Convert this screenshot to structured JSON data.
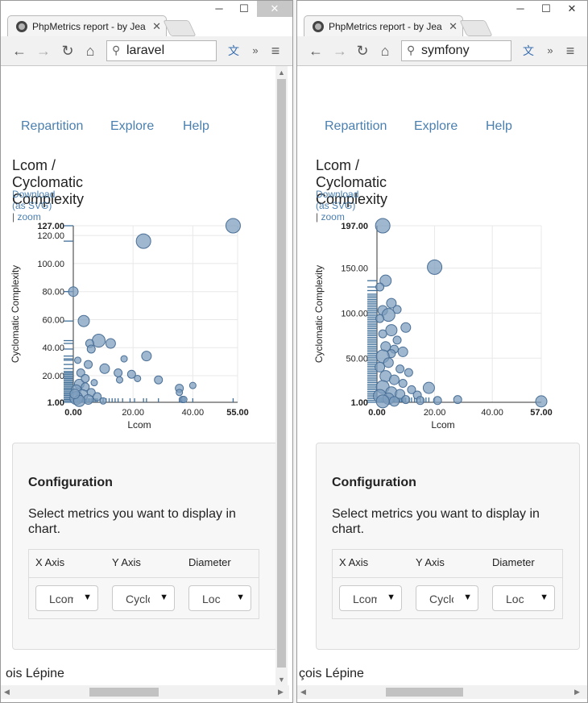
{
  "windows": [
    {
      "id": "left",
      "tab_title": "PhpMetrics report - by Jea",
      "omnibox_text": "laravel",
      "nav": [
        "Repartition",
        "Explore",
        "Help"
      ],
      "page_title": "Lcom / Cyclomatic Complexity",
      "download_link": "Download (as SVG)",
      "link_sep": "|",
      "zoom_link": "zoom",
      "footer_text": "ois Lépine",
      "chart_data": {
        "type": "scatter",
        "xlabel": "Lcom",
        "ylabel": "Cyclomatic Complexity",
        "xlim": [
          0,
          55
        ],
        "ylim": [
          1,
          127
        ],
        "x_ticks": [
          "0.00",
          "20.00",
          "40.00",
          "55.00"
        ],
        "x_tick_values": [
          0,
          20,
          40,
          55
        ],
        "y_ticks": [
          "1.00",
          "20.00",
          "40.00",
          "60.00",
          "80.00",
          "100.00",
          "120.00",
          "127.00"
        ],
        "y_tick_values": [
          1,
          20,
          40,
          60,
          80,
          100,
          120,
          127
        ],
        "bold_ticks": [
          "0.00",
          "55.00",
          "1.00",
          "127.00"
        ],
        "grid": true,
        "colors": {
          "fill": "#7f9fbf",
          "stroke": "#4a6f96",
          "rug": "#3f6f99"
        },
        "points": [
          {
            "x": 53.5,
            "y": 127,
            "d": 9
          },
          {
            "x": 23.5,
            "y": 116,
            "d": 9
          },
          {
            "x": 0,
            "y": 80,
            "d": 6
          },
          {
            "x": 3.5,
            "y": 59,
            "d": 7
          },
          {
            "x": 8.5,
            "y": 45,
            "d": 8
          },
          {
            "x": 5.5,
            "y": 43,
            "d": 5
          },
          {
            "x": 12.5,
            "y": 43,
            "d": 6
          },
          {
            "x": 6,
            "y": 39,
            "d": 5
          },
          {
            "x": 24.5,
            "y": 34,
            "d": 6
          },
          {
            "x": 17,
            "y": 32,
            "d": 4
          },
          {
            "x": 1.5,
            "y": 31,
            "d": 4
          },
          {
            "x": 5,
            "y": 28,
            "d": 5
          },
          {
            "x": 10.5,
            "y": 25,
            "d": 6
          },
          {
            "x": 15,
            "y": 22,
            "d": 5
          },
          {
            "x": 19.5,
            "y": 21,
            "d": 5
          },
          {
            "x": 2.5,
            "y": 22,
            "d": 5
          },
          {
            "x": 15.5,
            "y": 17,
            "d": 4
          },
          {
            "x": 21.5,
            "y": 18,
            "d": 4
          },
          {
            "x": 28.5,
            "y": 17,
            "d": 5
          },
          {
            "x": 40,
            "y": 13,
            "d": 4
          },
          {
            "x": 35.5,
            "y": 11,
            "d": 5
          },
          {
            "x": 35.5,
            "y": 8,
            "d": 4
          },
          {
            "x": 36.5,
            "y": 3,
            "d": 4
          },
          {
            "x": 37,
            "y": 3,
            "d": 4
          },
          {
            "x": 2,
            "y": 14,
            "d": 6
          },
          {
            "x": 4,
            "y": 12,
            "d": 5
          },
          {
            "x": 1,
            "y": 10,
            "d": 6
          },
          {
            "x": 6,
            "y": 8,
            "d": 5
          },
          {
            "x": 3,
            "y": 6,
            "d": 7
          },
          {
            "x": 8,
            "y": 5,
            "d": 5
          },
          {
            "x": 1,
            "y": 4,
            "d": 8
          },
          {
            "x": 5,
            "y": 3,
            "d": 6
          },
          {
            "x": 2,
            "y": 2,
            "d": 7
          },
          {
            "x": 10,
            "y": 2,
            "d": 4
          },
          {
            "x": 0.5,
            "y": 7,
            "d": 6
          },
          {
            "x": 4,
            "y": 18,
            "d": 5
          },
          {
            "x": 7,
            "y": 15,
            "d": 4
          }
        ],
        "rug_x": [
          0,
          0.5,
          1,
          1.5,
          2,
          2.5,
          3,
          3.5,
          4,
          4.5,
          5,
          5.5,
          6,
          6.5,
          7,
          7.5,
          8,
          9,
          10,
          11,
          12,
          13,
          14,
          15,
          16.5,
          19,
          20.5,
          23.5,
          24.5,
          28.5,
          35.5,
          36.5,
          37,
          40,
          53.5
        ],
        "rug_y": [
          1,
          2,
          3,
          4,
          5,
          6,
          7,
          8,
          9,
          10,
          11,
          12,
          13,
          14,
          15,
          16,
          17,
          18,
          19,
          20,
          21,
          22,
          23,
          25,
          28,
          31,
          32,
          34,
          39,
          43,
          45,
          59,
          80,
          116,
          127
        ]
      },
      "config": {
        "title": "Configuration",
        "description": "Select metrics you want to display in chart.",
        "headers": [
          "X Axis",
          "Y Axis",
          "Diameter"
        ],
        "selects": [
          "Lcom",
          "Cyclomatic",
          "Loc"
        ]
      }
    },
    {
      "id": "right",
      "tab_title": "PhpMetrics report - by Jea",
      "omnibox_text": "symfony",
      "nav": [
        "Repartition",
        "Explore",
        "Help"
      ],
      "page_title": "Lcom / Cyclomatic Complexity",
      "download_link": "Download (as SVG)",
      "link_sep": "|",
      "zoom_link": "zoom",
      "footer_text": "çois Lépine",
      "chart_data": {
        "type": "scatter",
        "xlabel": "Lcom",
        "ylabel": "Cyclomatic Complexity",
        "xlim": [
          0,
          57
        ],
        "ylim": [
          1,
          197
        ],
        "x_ticks": [
          "0.00",
          "20.00",
          "40.00",
          "57.00"
        ],
        "x_tick_values": [
          0,
          20,
          40,
          57
        ],
        "y_ticks": [
          "1.00",
          "50.00",
          "100.00",
          "150.00",
          "197.00"
        ],
        "y_tick_values": [
          1,
          50,
          100,
          150,
          197
        ],
        "bold_ticks": [
          "0.00",
          "57.00",
          "1.00",
          "197.00"
        ],
        "grid": true,
        "colors": {
          "fill": "#7f9fbf",
          "stroke": "#4a6f96",
          "rug": "#3f6f99"
        },
        "points": [
          {
            "x": 2,
            "y": 197,
            "d": 9
          },
          {
            "x": 20,
            "y": 151,
            "d": 9
          },
          {
            "x": 3,
            "y": 136,
            "d": 7
          },
          {
            "x": 1,
            "y": 129,
            "d": 5
          },
          {
            "x": 5,
            "y": 111,
            "d": 6
          },
          {
            "x": 2,
            "y": 103,
            "d": 6
          },
          {
            "x": 7,
            "y": 104,
            "d": 5
          },
          {
            "x": 4,
            "y": 98,
            "d": 8
          },
          {
            "x": 1,
            "y": 94,
            "d": 5
          },
          {
            "x": 10,
            "y": 84,
            "d": 6
          },
          {
            "x": 5,
            "y": 81,
            "d": 7
          },
          {
            "x": 2,
            "y": 77,
            "d": 5
          },
          {
            "x": 7,
            "y": 70,
            "d": 5
          },
          {
            "x": 3,
            "y": 63,
            "d": 6
          },
          {
            "x": 6,
            "y": 60,
            "d": 5
          },
          {
            "x": 9,
            "y": 57,
            "d": 6
          },
          {
            "x": 5,
            "y": 55,
            "d": 5
          },
          {
            "x": 2,
            "y": 52,
            "d": 8
          },
          {
            "x": 4,
            "y": 45,
            "d": 6
          },
          {
            "x": 1,
            "y": 40,
            "d": 6
          },
          {
            "x": 8,
            "y": 38,
            "d": 5
          },
          {
            "x": 11,
            "y": 34,
            "d": 5
          },
          {
            "x": 3,
            "y": 30,
            "d": 7
          },
          {
            "x": 6,
            "y": 26,
            "d": 6
          },
          {
            "x": 9,
            "y": 22,
            "d": 5
          },
          {
            "x": 18,
            "y": 17,
            "d": 7
          },
          {
            "x": 12,
            "y": 15,
            "d": 5
          },
          {
            "x": 2,
            "y": 18,
            "d": 8
          },
          {
            "x": 5,
            "y": 12,
            "d": 7
          },
          {
            "x": 8,
            "y": 10,
            "d": 6
          },
          {
            "x": 14,
            "y": 9,
            "d": 5
          },
          {
            "x": 1,
            "y": 8,
            "d": 8
          },
          {
            "x": 4,
            "y": 5,
            "d": 7
          },
          {
            "x": 10,
            "y": 4,
            "d": 5
          },
          {
            "x": 15,
            "y": 3,
            "d": 5
          },
          {
            "x": 21,
            "y": 3,
            "d": 5
          },
          {
            "x": 28,
            "y": 4,
            "d": 5
          },
          {
            "x": 2,
            "y": 2,
            "d": 8
          },
          {
            "x": 6,
            "y": 2,
            "d": 6
          },
          {
            "x": 57,
            "y": 2,
            "d": 7
          }
        ],
        "rug_x": [
          0,
          0.5,
          1,
          1.5,
          2,
          2.5,
          3,
          3.5,
          4,
          4.5,
          5,
          5.5,
          6,
          6.5,
          7,
          7.5,
          8,
          8.5,
          9,
          9.5,
          10,
          11,
          12,
          13,
          14,
          15,
          16,
          17,
          18,
          20
        ],
        "rug_y": [
          1,
          3,
          5,
          7,
          9,
          11,
          13,
          15,
          17,
          19,
          21,
          23,
          25,
          27,
          29,
          31,
          33,
          35,
          37,
          39,
          41,
          43,
          45,
          47,
          49,
          51,
          53,
          55,
          57,
          59,
          61,
          63,
          65,
          67,
          69,
          71,
          73,
          75,
          77,
          79,
          81,
          83,
          85,
          87,
          89,
          91,
          93,
          95,
          97,
          99,
          101,
          103,
          105,
          107,
          109,
          111,
          113,
          115,
          117,
          119,
          121,
          125,
          129,
          136
        ],
        "rug_x_len": 6
      },
      "config": {
        "title": "Configuration",
        "description": "Select metrics you want to display in chart.",
        "headers": [
          "X Axis",
          "Y Axis",
          "Diameter"
        ],
        "selects": [
          "Lcom",
          "Cyclomatic",
          "Loc"
        ]
      }
    }
  ]
}
